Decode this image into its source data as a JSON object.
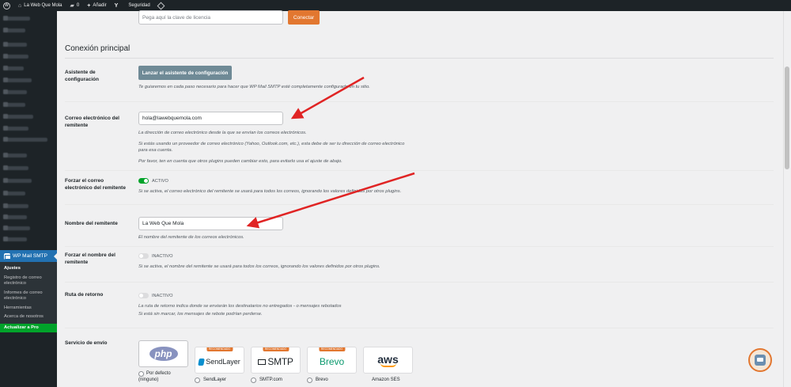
{
  "adminbar": {
    "site_name": "La Web Que Mola",
    "comments_count": "0",
    "new_label": "Añadir",
    "security_label": "Seguridad"
  },
  "sidebar": {
    "plugin_menu": "WP Mail SMTP",
    "submenu": [
      "Ajustes",
      "Registro de correo electrónico",
      "Informes de correo electrónico",
      "Herramientas",
      "Acerca de nosotros",
      "Actualizar a Pro"
    ]
  },
  "license": {
    "placeholder": "Pega aquí la clave de licencia",
    "connect_button": "Conectar"
  },
  "section": {
    "title": "Conexión principal"
  },
  "wizard": {
    "label": "Asistente de configuración",
    "button": "Lanzar el asistente de configuración",
    "description": "Te guiaremos en cada paso necesario para hacer que WP Mail SMTP esté completamente configurado en tu sitio."
  },
  "from_email": {
    "label": "Correo electrónico del remitente",
    "value": "hola@lawebquemola.com",
    "desc1": "La dirección de correo electrónico desde la que se envían los correos electrónicos.",
    "desc2": "Si estás usando un proveedor de correo electrónico (Yahoo, Outlook.com, etc.), esta debe de ser tu dirección de correo electrónico para esa cuenta.",
    "desc3": "Por favor, ten en cuenta que otros plugins pueden cambiar esto, para evitarlo usa el ajuste de abajo."
  },
  "force_email": {
    "label": "Forzar el correo electrónico del remitente",
    "state": "ACTIVO",
    "enabled": true,
    "description": "Si se activa, el correo electrónico del remitente se usará para todos los correos, ignorando los valores definidos por otros plugins."
  },
  "from_name": {
    "label": "Nombre del remitente",
    "value": "La Web Que Mola",
    "description": "El nombre del remitente de los correos electrónicos."
  },
  "force_name": {
    "label": "Forzar el nombre del remitente",
    "state": "INACTIVO",
    "enabled": false,
    "description": "Si se activa, el nombre del remitente se usará para todos los correos, ignorando los valores definidos por otros plugins."
  },
  "return_path": {
    "label": "Ruta de retorno",
    "state": "INACTIVO",
    "enabled": false,
    "desc1": "La ruta de retorno indica donde se enviarán los destinatarios no entregados - o mensajes rebotados",
    "desc2": "Si está sin marcar, los mensajes de rebote podrían perderse."
  },
  "mailer": {
    "label": "Servicio de envío",
    "recommended_badge": "RECOMENDADO",
    "options": [
      {
        "logo": "php",
        "label": "Por defecto (ninguno)",
        "recommended": false
      },
      {
        "logo": "SendLayer",
        "label": "SendLayer",
        "recommended": true
      },
      {
        "logo": "SMTP",
        "label": "SMTP.com",
        "recommended": true
      },
      {
        "logo": "Brevo",
        "label": "Brevo",
        "recommended": true
      },
      {
        "logo": "aws",
        "label": "Amazon SES",
        "recommended": false
      }
    ]
  },
  "colors": {
    "accent": "#e27730",
    "toggle_on": "#00a32a",
    "admin_blue": "#2271b1",
    "arrow": "#e02424"
  }
}
